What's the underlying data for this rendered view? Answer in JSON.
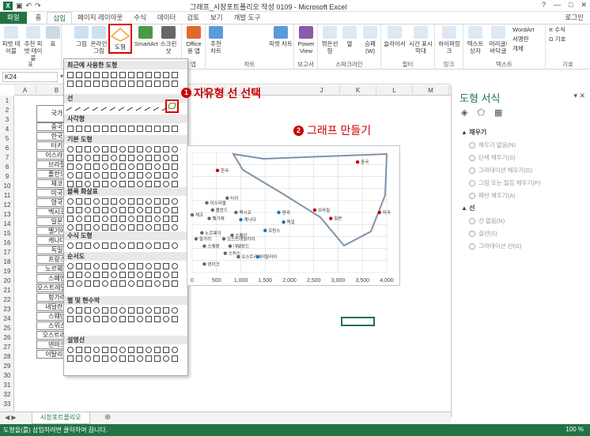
{
  "title": "그래프_시장포트폴리오 작성 0109 - Microsoft Excel",
  "window_controls": [
    "?",
    "—",
    "□",
    "✕"
  ],
  "tabs": [
    "파일",
    "홈",
    "삽입",
    "페이지 레이아웃",
    "수식",
    "데이터",
    "검토",
    "보기",
    "개발 도구"
  ],
  "active_tab": "삽입",
  "login": "로그인",
  "ribbon": {
    "buttons": [
      "피벗 테이블",
      "추천 피벗 테이블",
      "표",
      "그림",
      "온라인 그림",
      "도형",
      "SmartArt",
      "스크린샷",
      "Office용 앱",
      "추천 차트",
      "피벗 차트",
      "Power View",
      "꺾은선형",
      "열",
      "승패(W)",
      "슬라이서",
      "시간 표시 막대",
      "하이퍼링크",
      "텍스트 상자",
      "머리글/바닥글",
      "WordArt",
      "서명란",
      "개체",
      "수식",
      "기호"
    ],
    "groups": [
      "표",
      "앱",
      "차트",
      "보고서",
      "스파크라인",
      "필터",
      "링크",
      "텍스트",
      "기호"
    ]
  },
  "namebox": "K24",
  "columns": [
    "A",
    "B",
    "C",
    "D",
    "E",
    "F",
    "G",
    "H",
    "I",
    "J",
    "K",
    "L",
    "M"
  ],
  "countries": [
    "국가",
    "중국",
    "한국",
    "터키",
    "이스라엘",
    "브라질",
    "폴란드",
    "체코",
    "미국",
    "영국",
    "멕시코",
    "일본",
    "벨기에",
    "캐나다",
    "독일",
    "프랑스",
    "노르웨이",
    "스페인",
    "오스트레일리아",
    "헝가리",
    "네덜란드",
    "스웨덴",
    "스위스",
    "오스트리아",
    "덴마크",
    "이탈리아"
  ],
  "rows": [
    "1",
    "2",
    "3",
    "4",
    "5",
    "6",
    "7",
    "8",
    "9",
    "10",
    "11",
    "12",
    "13",
    "14",
    "15",
    "16",
    "17",
    "18",
    "19",
    "20",
    "21",
    "22",
    "23",
    "24",
    "25",
    "26",
    "27",
    "28",
    "29",
    "30",
    "31",
    "32",
    "33"
  ],
  "dropdown": {
    "sections": [
      "최근에 사용한 도형",
      "선",
      "사각형",
      "기본 도형",
      "블록 화살표",
      "수식 도형",
      "순서도",
      "별 및 현수막",
      "설명선"
    ]
  },
  "annotations": {
    "step1_num": "1",
    "step1_text": "자유형 선 선택",
    "step2_num": "2",
    "step2_text": "그래프 만들기"
  },
  "chart_data": {
    "type": "scatter",
    "x_ticks": [
      "0",
      "500",
      "1,000",
      "1,500",
      "2,000",
      "2,500",
      "3,000",
      "3,500",
      "4,000"
    ],
    "xlim": [
      0,
      4000
    ],
    "grid": true,
    "points": [
      {
        "label": "중국",
        "x": 3400,
        "y": 0.92,
        "color": "#c00000"
      },
      {
        "label": "한국",
        "x": 520,
        "y": 0.85,
        "color": "#c00000"
      },
      {
        "label": "터키",
        "x": 720,
        "y": 0.62,
        "color": "#666666"
      },
      {
        "label": "이스라엘",
        "x": 300,
        "y": 0.58,
        "color": "#666666"
      },
      {
        "label": "브라질",
        "x": 2520,
        "y": 0.52,
        "color": "#c00000"
      },
      {
        "label": "폴란드",
        "x": 420,
        "y": 0.52,
        "color": "#666666"
      },
      {
        "label": "멕시코",
        "x": 900,
        "y": 0.5,
        "color": "#666666"
      },
      {
        "label": "체코",
        "x": 0,
        "y": 0.48,
        "color": "#666666"
      },
      {
        "label": "미국",
        "x": 3850,
        "y": 0.5,
        "color": "#c00000"
      },
      {
        "label": "영국",
        "x": 1780,
        "y": 0.5,
        "color": "#1f6fb4"
      },
      {
        "label": "일본",
        "x": 2850,
        "y": 0.45,
        "color": "#c00000"
      },
      {
        "label": "벨기에",
        "x": 350,
        "y": 0.45,
        "color": "#666666"
      },
      {
        "label": "캐나다",
        "x": 1000,
        "y": 0.44,
        "color": "#1f6fb4"
      },
      {
        "label": "독일",
        "x": 1880,
        "y": 0.42,
        "color": "#1f6fb4"
      },
      {
        "label": "프랑스",
        "x": 1500,
        "y": 0.35,
        "color": "#1f6fb4"
      },
      {
        "label": "노르웨이",
        "x": 200,
        "y": 0.33,
        "color": "#666666"
      },
      {
        "label": "스페인",
        "x": 820,
        "y": 0.31,
        "color": "#666666"
      },
      {
        "label": "오스트레일리아",
        "x": 650,
        "y": 0.28,
        "color": "#666666"
      },
      {
        "label": "헝가리",
        "x": 80,
        "y": 0.28,
        "color": "#666666"
      },
      {
        "label": "네덜란드",
        "x": 780,
        "y": 0.22,
        "color": "#666666"
      },
      {
        "label": "스웨덴",
        "x": 250,
        "y": 0.22,
        "color": "#666666"
      },
      {
        "label": "스위스",
        "x": 680,
        "y": 0.16,
        "color": "#666666"
      },
      {
        "label": "오스트리아",
        "x": 950,
        "y": 0.13,
        "color": "#666666"
      },
      {
        "label": "덴마크",
        "x": 250,
        "y": 0.07,
        "color": "#666666"
      },
      {
        "label": "이탈리아",
        "x": 1350,
        "y": 0.13,
        "color": "#1f6fb4"
      }
    ]
  },
  "pane": {
    "title": "도형 서식",
    "fill_header": "채우기",
    "fill_options": [
      "채우기 없음(N)",
      "단색 채우기(S)",
      "그라데이션 채우기(G)",
      "그림 또는 질감 채우기(P)",
      "패턴 채우기(A)"
    ],
    "line_header": "선",
    "line_options": [
      "선 없음(N)",
      "실선(S)",
      "그라데이션 선(G)"
    ]
  },
  "sheet_tab": "시장포트폴리오",
  "status": "도형을(를) 삽입하려면 클릭하여 끕니다.",
  "zoom": "100 %"
}
